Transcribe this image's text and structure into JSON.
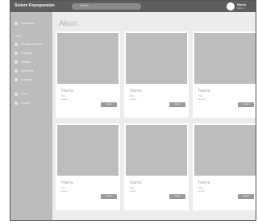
{
  "header": {
    "brand": "Sistem Kepegawaian",
    "search_placeholder": "Search",
    "user_name": "Nama",
    "user_role": "Admin"
  },
  "sidebar": {
    "dashboard": "Dashboard",
    "section": "Akun",
    "items": [
      "Pengaturan Akun",
      "Pegawai",
      "Jabatan",
      "Unit Kerja",
      "Golongan"
    ],
    "bottom_items": [
      "Profil",
      "Logout"
    ]
  },
  "main": {
    "title": "Akun",
    "cards": [
      {
        "name": "Nama",
        "type": "Tipe",
        "email": "Email",
        "button": "Detail"
      },
      {
        "name": "Nama",
        "type": "Tipe",
        "email": "Email",
        "button": "Detail"
      },
      {
        "name": "Nama",
        "type": "Tipe",
        "email": "Email",
        "button": "Detail"
      },
      {
        "name": "Nama",
        "type": "Tipe",
        "email": "Email",
        "button": "Detail"
      },
      {
        "name": "Nama",
        "type": "Tipe",
        "email": "Email",
        "button": "Detail"
      },
      {
        "name": "Nama",
        "type": "Tipe",
        "email": "Email",
        "button": "Detail"
      }
    ]
  }
}
